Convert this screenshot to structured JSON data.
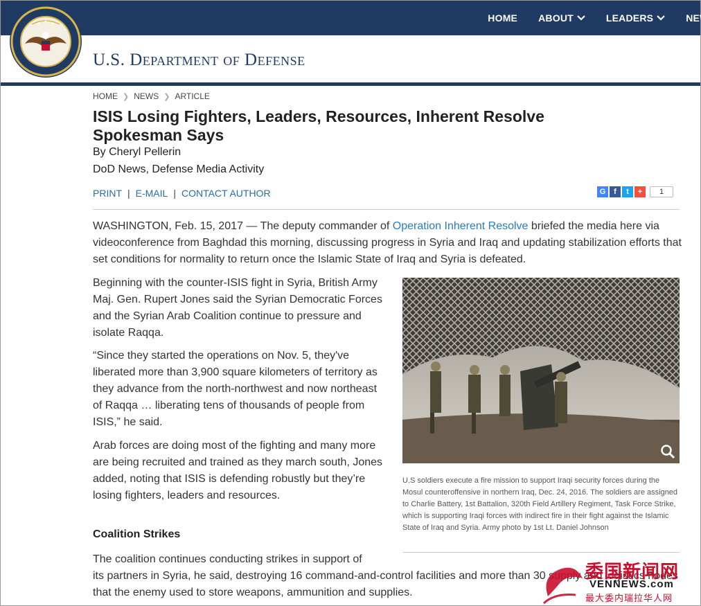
{
  "nav": {
    "items": [
      {
        "label": "HOME",
        "dropdown": false
      },
      {
        "label": "ABOUT",
        "dropdown": true
      },
      {
        "label": "LEADERS",
        "dropdown": true
      },
      {
        "label": "NEWS",
        "dropdown": false
      }
    ]
  },
  "site": {
    "title": "U.S. Department of Defense",
    "seal_icon": "dod-seal-icon",
    "brand_color": "#1f3b64"
  },
  "breadcrumb": [
    "HOME",
    "NEWS",
    "ARTICLE"
  ],
  "article": {
    "headline": "ISIS Losing Fighters, Leaders, Resources, Inherent Resolve Spokesman Says",
    "byline": "By Cheryl Pellerin",
    "source": "DoD News, Defense Media Activity",
    "actions": [
      "PRINT",
      "E-MAIL",
      "CONTACT AUTHOR"
    ],
    "share": {
      "buttons": [
        {
          "icon": "google-plus-icon",
          "glyph": "G",
          "color": "#4285f4"
        },
        {
          "icon": "facebook-icon",
          "glyph": "f",
          "color": "#3b5998"
        },
        {
          "icon": "twitter-icon",
          "glyph": "t",
          "color": "#1da1f2"
        },
        {
          "icon": "addthis-plus-icon",
          "glyph": "+",
          "color": "#f0503c"
        }
      ],
      "count": "1"
    },
    "lede_prefix": "WASHINGTON, Feb. 15, 2017 — The deputy commander of ",
    "lede_link": "Operation Inherent Resolve",
    "lede_suffix": " briefed the media here via videoconference from Baghdad this morning, discussing progress in Syria and Iraq and updating stabilization efforts that set conditions for normality to return once the Islamic State of Iraq and Syria is defeated.",
    "paragraphs": [
      "Beginning with the counter-ISIS fight in Syria, British Army Maj. Gen. Rupert Jones said the Syrian Democratic Forces and the Syrian Arab Coalition continue to pressure and isolate Raqqa.",
      "“Since they started the operations on Nov. 5, they've liberated more than 3,900 square kilometers of territory as they advance from the north-northwest and now northeast of Raqqa … liberating tens of thousands of people from ISIS,” he said.",
      "Arab forces are doing most of the fighting and many more are being recruited and trained as they march south, Jones added, noting that ISIS is defending robustly but they’re losing fighters, leaders and resources."
    ],
    "subhead": "Coalition Strikes",
    "p4_line1": "The coalition continues conducting strikes in support of",
    "p4_rest": "its partners in Syria, he said, destroying 16 command-and-control facilities and more than 30 supply and logistics nodes that the enemy used to store weapons, ammunition and supplies.",
    "photo_caption": "U.S soldiers execute a fire mission to support Iraqi security forces during the Mosul counteroffensive in northern Iraq, Dec. 24, 2016. The soldiers are assigned to Charlie Battery, 1st Battalion, 320th Field Artillery Regiment, Task Force Strike, which is supporting Iraqi forces with indirect fire in their fight against the Islamic State of Iraq and Syria. Army photo by 1st Lt. Daniel Johnson",
    "link_color": "#2a7bbd"
  },
  "watermark": {
    "cn": "委国新闻网",
    "en": "VENNEWS.com",
    "sub": "最大委内瑞拉华人网"
  }
}
